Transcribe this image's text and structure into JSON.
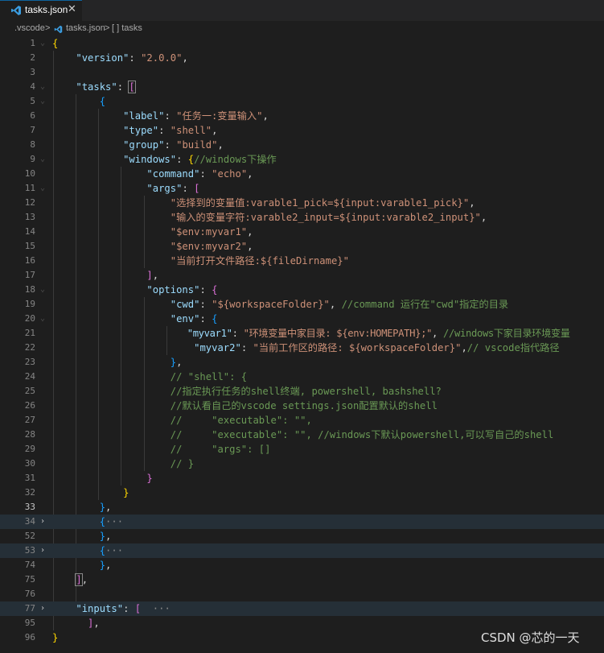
{
  "tab": {
    "filename": "tasks.json",
    "close_glyph": "✕"
  },
  "breadcrumb": {
    "folder": ".vscode",
    "sep1": ">",
    "file": "tasks.json",
    "sep2": ">",
    "symbol": "[ ] tasks"
  },
  "watermark": "CSDN @芯的一天",
  "line_numbers": [
    "1",
    "2",
    "3",
    "4",
    "5",
    "6",
    "7",
    "8",
    "9",
    "10",
    "11",
    "12",
    "13",
    "14",
    "15",
    "16",
    "17",
    "18",
    "19",
    "20",
    "21",
    "22",
    "23",
    "24",
    "25",
    "26",
    "27",
    "28",
    "29",
    "30",
    "31",
    "32",
    "33",
    "34",
    "52",
    "53",
    "74",
    "75",
    "76",
    "77",
    "95",
    "96"
  ],
  "code": {
    "l1": "{",
    "l2_key": "\"version\"",
    "l2_val": "\"2.0.0\"",
    "l4_key": "\"tasks\"",
    "l4_open": "[",
    "l5": "{",
    "l6_key": "\"label\"",
    "l6_val": "\"任务一:变量输入\"",
    "l7_key": "\"type\"",
    "l7_val": "\"shell\"",
    "l8_key": "\"group\"",
    "l8_val": "\"build\"",
    "l9_key": "\"windows\"",
    "l9_open": "{",
    "l9_comment": "//windows下操作",
    "l10_key": "\"command\"",
    "l10_val": "\"echo\"",
    "l11_key": "\"args\"",
    "l11_open": "[",
    "l12_val": "\"选择到的变量值:varable1_pick=${input:varable1_pick}\"",
    "l13_val": "\"输入的变量字符:varable2_input=${input:varable2_input}\"",
    "l14_val": "\"$env:myvar1\"",
    "l15_val": "\"$env:myvar2\"",
    "l16_val": "\"当前打开文件路径:${fileDirname}\"",
    "l17_close": "]",
    "l18_key": "\"options\"",
    "l18_open": "{",
    "l19_key": "\"cwd\"",
    "l19_val": "\"${workspaceFolder}\"",
    "l19_comment": "//command 运行在\"cwd\"指定的目录",
    "l20_key": "\"env\"",
    "l20_open": "{",
    "l21_key": "\"myvar1\"",
    "l21_val": "\"环境变量中家目录: ${env:HOMEPATH};\"",
    "l21_comment": "//windows下家目录环境变量",
    "l22_key": "\"myvar2\"",
    "l22_val": "\"当前工作区的路径: ${workspaceFolder}\"",
    "l22_comment": "// vscode指代路径",
    "l23_close": "}",
    "l24": "// \"shell\": {",
    "l25": "//指定执行任务的shell终端, powershell, bashshell?",
    "l26": "//默认看自己的vscode settings.json配置默认的shell",
    "l27": "//     \"executable\": \"\",",
    "l28": "//     \"executable\": \"\", //windows下默认powershell,可以写自己的shell",
    "l29": "//     \"args\": []",
    "l30": "// }",
    "l31_close": "}",
    "l32_close": "}",
    "l33_close": "}",
    "l34_open": "{",
    "l34_dots": "···",
    "l52_close": "}",
    "l53_open": "{",
    "l53_dots": "···",
    "l74_close": "}",
    "l75_close": "]",
    "l77_key": "\"inputs\"",
    "l77_open": "[",
    "l77_dots": "···",
    "l95_close": "]",
    "l96": "}"
  },
  "colors": {
    "background": "#1e1e1e",
    "key": "#9cdcfe",
    "string": "#ce9178",
    "comment": "#6a9955",
    "bracket_gold": "#ffd700",
    "bracket_purple": "#da70d6",
    "bracket_blue": "#179fff",
    "tab_accent": "#0e639c"
  },
  "icons": {
    "file": "vscode-json-icon",
    "fold_open": "chevron-down-icon",
    "fold_closed": "chevron-right-icon"
  }
}
